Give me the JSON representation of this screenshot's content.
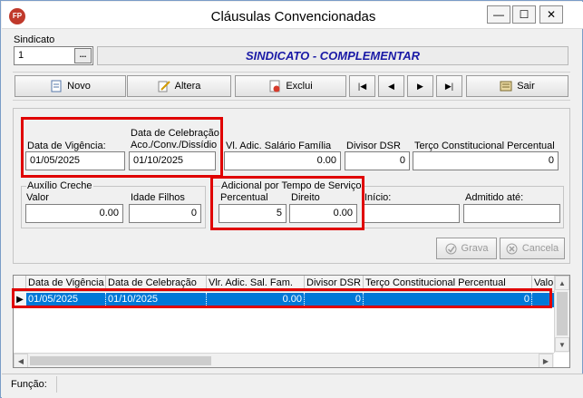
{
  "window": {
    "title": "Cláusulas Convencionadas",
    "app_icon_text": "FP"
  },
  "window_controls": {
    "minimize": "—",
    "maximize": "☐",
    "close": "✕"
  },
  "sindicato": {
    "label": "Sindicato",
    "code": "1",
    "lookup_label": "...",
    "name": "SINDICATO - COMPLEMENTAR"
  },
  "toolbar": {
    "novo": "Novo",
    "altera": "Altera",
    "exclui": "Exclui",
    "first": "|◀",
    "prev": "◀",
    "next": "▶",
    "last": "▶|",
    "sair": "Sair"
  },
  "form": {
    "data_vigencia": {
      "label": "Data de Vigência:",
      "value": "01/05/2025"
    },
    "data_celebracao": {
      "label1": "Data de Celebração",
      "label2": "Aco./Conv./Dissídio",
      "value": "01/10/2025"
    },
    "vl_adic_salario_familia": {
      "label": "Vl. Adic. Salário Família",
      "value": "0.00"
    },
    "divisor_dsr": {
      "label": "Divisor DSR",
      "value": "0"
    },
    "terco_constitucional": {
      "label": "Terço Constitucional Percentual",
      "value": "0"
    },
    "auxilio_creche": {
      "label": "Auxílio Creche",
      "valor_label": "Valor",
      "valor": "0.00",
      "idade_label": "Idade Filhos",
      "idade": "0"
    },
    "adicional_tempo_servico": {
      "label": "Adicional por Tempo de Serviço",
      "percentual_label": "Percentual",
      "percentual": "5",
      "direito_label": "Direito",
      "direito": "0.00"
    },
    "inicio": {
      "label": "Início:",
      "value": ""
    },
    "admitido_ate": {
      "label": "Admitido até:",
      "value": ""
    },
    "grava": "Grava",
    "cancela": "Cancela"
  },
  "grid": {
    "columns": [
      "Data de Vigência",
      "Data de Celebração",
      "Vlr. Adic. Sal. Fam.",
      "Divisor DSR",
      "Terço Constitucional Percentual",
      "Valo"
    ],
    "rows": [
      {
        "vigencia": "01/05/2025",
        "celebracao": "01/10/2025",
        "adic": "0.00",
        "dsr": "0",
        "terco": "0"
      }
    ],
    "row_indicator": "▶"
  },
  "status": {
    "funcao_label": "Função:",
    "funcao_value": ""
  },
  "colors": {
    "highlight_red": "#e00000",
    "selected_row": "#0078d7",
    "title_blue": "#1a1aa6"
  }
}
